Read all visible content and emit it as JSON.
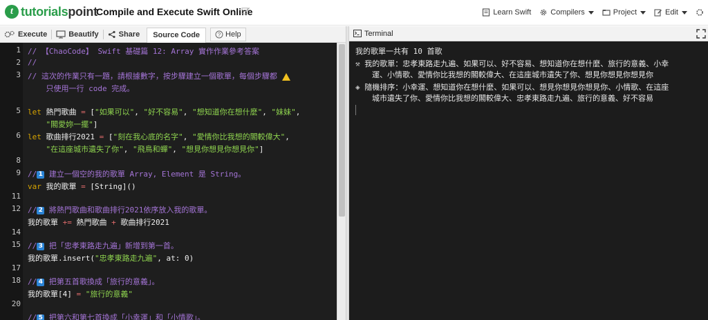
{
  "header": {
    "logo_part1": "tutorials",
    "logo_part2": "point",
    "title": "Compile and Execute Swift Online",
    "nav": {
      "learn": "Learn Swift",
      "compilers": "Compilers",
      "project": "Project",
      "edit": "Edit"
    }
  },
  "toolbar": {
    "execute": "Execute",
    "beautify": "Beautify",
    "share": "Share",
    "source_code": "Source Code",
    "help": "Help"
  },
  "editor": {
    "line_numbers": [
      "1",
      "2",
      "3",
      "",
      "5",
      "",
      "6",
      "",
      "8",
      "9",
      "",
      "11",
      "12",
      "",
      "14",
      "15",
      "",
      "17",
      "18",
      "",
      "20"
    ],
    "lines": [
      [
        "// 【ChaoCode】 Swift 基礎篇 12: Array 實作作業參考答案"
      ],
      [
        "//"
      ],
      [
        "// 這次的作業只有一題，請根據數字，按步驟建立一個歌單，每個步驟都 "
      ],
      [
        "    只使用一行 code 完成。"
      ],
      [
        "let",
        " 熱門歌曲 ",
        "=",
        " [",
        "\"如果可以\"",
        ", ",
        "\"好不容易\"",
        ", ",
        "\"想知道你在想什麼\"",
        ", ",
        "\"妹妹\"",
        ","
      ],
      [
        "    ",
        "\"閣愛妳一擺\"",
        "]"
      ],
      [
        "let",
        " 歌曲排行2021 ",
        "=",
        " [",
        "\"刻在我心底的名字\"",
        ", ",
        "\"愛情你比我想的閣較偉大\"",
        ","
      ],
      [
        "    ",
        "\"在這座城市遺失了你\"",
        ", ",
        "\"飛鳥和蟬\"",
        ", ",
        "\"想見你想見你想見你\"",
        "]"
      ],
      [
        "//",
        "1",
        " 建立一個空的我的歌單 Array, Element 是 String。"
      ],
      [
        "var",
        " 我的歌單 ",
        "=",
        " [String]()"
      ],
      [
        "//",
        "2",
        " 將熱門歌曲和歌曲排行2021依序放入我的歌單。"
      ],
      [
        "我的歌單 ",
        "+=",
        " 熱門歌曲 ",
        "+",
        " 歌曲排行2021"
      ],
      [
        "//",
        "3",
        " 把「忠孝東路走九遍」新增到第一首。"
      ],
      [
        "我的歌單.insert(",
        "\"忠孝東路走九遍\"",
        ", at: 0)"
      ],
      [
        "//",
        "4",
        " 把第五首歌換成「旅行的意義」。"
      ],
      [
        "我的歌單[4] ",
        "=",
        " ",
        "\"旅行的意義\""
      ],
      [
        "//",
        "5",
        " 把第六和第七首換成「小幸運」和「小情歌」。"
      ]
    ]
  },
  "terminal": {
    "title": "Terminal",
    "count_line": "我的歌單一共有 10 首歌",
    "songs_label": "我的歌單：忠孝東路走九遍、如果可以、好不容易、想知道你在想什麼、旅行的意義、小幸",
    "songs_cont": "運、小情歌、愛情你比我想的閣較偉大、在這座城市遺失了你、想見你想見你想見你",
    "shuffle_label": "隨機排序：小幸運、想知道你在想什麼、如果可以、想見你想見你想見你、小情歌、在這座",
    "shuffle_cont": "城市遺失了你、愛情你比我想的閣較偉大、忠孝東路走九遍、旅行的意義、好不容易"
  },
  "icons": {
    "logo": "tutorialspoint-logo",
    "pencil": "edit-pencil-icon",
    "book": "book-icon",
    "gear": "gear-icon",
    "folder": "folder-icon",
    "edit": "edit-icon",
    "settings": "settings-icon",
    "execute": "execute-gears-icon",
    "beautify": "beautify-icon",
    "share": "share-icon",
    "help": "help-circle-icon",
    "terminal": "terminal-icon",
    "expand": "expand-icon",
    "hammer": "hammer-emoji-icon",
    "cube": "cube-emoji-icon",
    "warning": "warning-icon"
  },
  "colors": {
    "brand_green": "#2a9d4a",
    "editor_bg": "#1e1e1e",
    "terminal_bg": "#1c1c1c",
    "comment": "#a474d6",
    "keyword": "#d8a400",
    "string": "#8fd44f",
    "badge_blue": "#2b84d6"
  }
}
